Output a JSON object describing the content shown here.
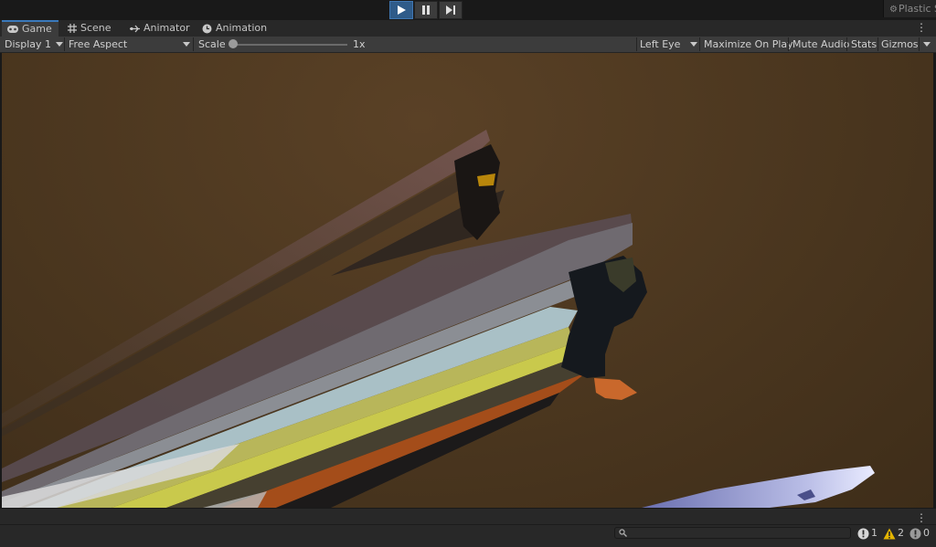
{
  "toolbar_top": {
    "play": "play-icon",
    "pause": "pause-icon",
    "step": "step-icon",
    "plastic_label": "Plastic S"
  },
  "tabs": [
    {
      "label": "Game",
      "icon": "gamepad-icon",
      "active": true
    },
    {
      "label": "Scene",
      "icon": "grid-icon",
      "active": false
    },
    {
      "label": "Animator",
      "icon": "animator-icon",
      "active": false
    },
    {
      "label": "Animation",
      "icon": "clock-icon",
      "active": false
    }
  ],
  "game_toolbar": {
    "display": "Display 1",
    "aspect": "Free Aspect",
    "scale_label": "Scale",
    "scale_value": "1x",
    "scale_slider_fraction": 0.0,
    "eye": "Left Eye",
    "maximize": "Maximize On Play",
    "mute": "Mute Audio",
    "stats": "Stats",
    "gizmos": "Gizmos"
  },
  "console": {
    "search_placeholder": "",
    "info_count": "1",
    "warning_count": "2",
    "error_count": "0"
  },
  "colors": {
    "accent": "#3a79bb",
    "play_active": "#2f5b89",
    "viewport_bg": "#4d3820",
    "warning": "#e3b400"
  }
}
